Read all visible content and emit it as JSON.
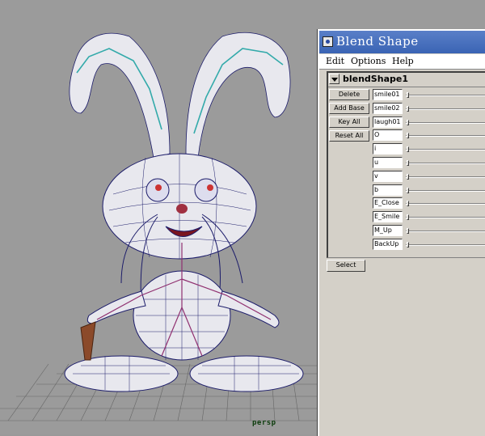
{
  "viewport": {
    "camera_label": "persp"
  },
  "window": {
    "title": "Blend Shape",
    "menu": [
      "Edit",
      "Options",
      "Help"
    ],
    "node_name": "blendShape1",
    "buttons": [
      "Delete",
      "Add Base",
      "Key All",
      "Reset All"
    ],
    "targets": [
      {
        "name": "smile01",
        "weight": 0
      },
      {
        "name": "smile02",
        "weight": 0
      },
      {
        "name": "laugh01",
        "weight": 0
      },
      {
        "name": "O",
        "weight": 0
      },
      {
        "name": "i",
        "weight": 0
      },
      {
        "name": "u",
        "weight": 0
      },
      {
        "name": "v",
        "weight": 0
      },
      {
        "name": "b",
        "weight": 0
      },
      {
        "name": "E_Close",
        "weight": 0
      },
      {
        "name": "E_Smile",
        "weight": 0
      },
      {
        "name": "M_Up",
        "weight": 0
      },
      {
        "name": "BackUp",
        "weight": 0
      }
    ],
    "select_label": "Select"
  },
  "colors": {
    "title_bar": "#3a64b4",
    "panel": "#d4d0c8",
    "viewport": "#9b9b9b"
  }
}
